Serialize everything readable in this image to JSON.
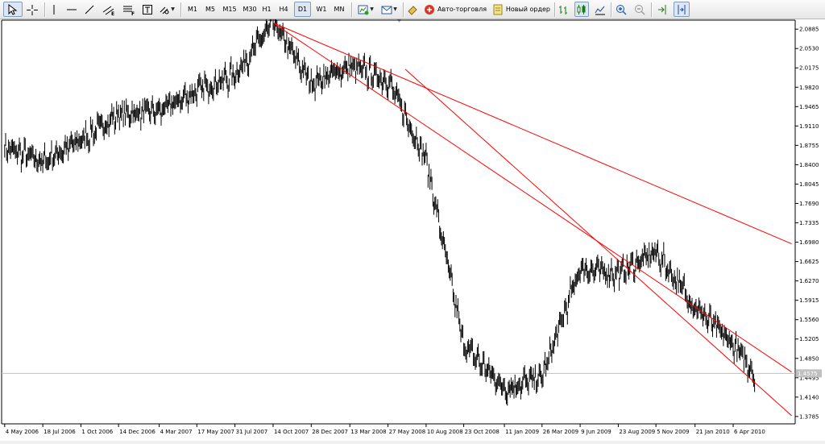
{
  "toolbar": {
    "timeframes": [
      "M1",
      "M5",
      "M15",
      "M30",
      "H1",
      "H4",
      "D1",
      "W1",
      "MN"
    ],
    "active_timeframe": "D1",
    "autotrading_label": "Авто-торговля",
    "new_order_label": "Новый ордер"
  },
  "chart_data": {
    "type": "line",
    "y_ticks": [
      "2.0885",
      "2.0530",
      "2.0175",
      "1.9820",
      "1.9465",
      "1.9110",
      "1.8755",
      "1.8400",
      "1.8045",
      "1.7690",
      "1.7335",
      "1.6980",
      "1.6625",
      "1.6270",
      "1.5915",
      "1.5560",
      "1.5205",
      "1.4850",
      "1.4495",
      "1.4140",
      "1.3785"
    ],
    "x_ticks": [
      "4 May 2006",
      "18 Jul 2006",
      "1 Oct 2006",
      "14 Dec 2006",
      "4 Mar 2007",
      "17 May 2007",
      "31 Jul 2007",
      "14 Oct 2007",
      "28 Dec 2007",
      "13 Mar 2008",
      "27 May 2008",
      "10 Aug 2008",
      "23 Oct 2008",
      "11 Jan 2009",
      "26 Mar 2009",
      "9 Jun 2009",
      "23 Aug 2009",
      "5 Nov 2009",
      "21 Jan 2010",
      "6 Apr 2010"
    ],
    "current_price_label": "1.4575",
    "ylim": [
      1.365,
      2.105
    ],
    "x": [
      "4 May 2006",
      "18 Jul 2006",
      "1 Oct 2006",
      "14 Dec 2006",
      "4 Mar 2007",
      "17 May 2007",
      "31 Jul 2007",
      "14 Oct 2007",
      "28 Dec 2007",
      "13 Mar 2008",
      "27 May 2008",
      "10 Aug 2008",
      "23 Oct 2008",
      "11 Jan 2009",
      "26 Mar 2009",
      "9 Jun 2009",
      "23 Aug 2009",
      "5 Nov 2009",
      "21 Jan 2010",
      "6 Apr 2010",
      "20 May 2010"
    ],
    "close": [
      1.871,
      1.845,
      1.885,
      1.932,
      1.938,
      1.975,
      2.005,
      2.1,
      1.99,
      2.02,
      1.995,
      1.85,
      1.51,
      1.43,
      1.45,
      1.65,
      1.64,
      1.68,
      1.58,
      1.51,
      1.455
    ],
    "trendlines": [
      {
        "from": [
          "14 Oct 2007",
          2.1
        ],
        "to": [
          "30 Jul 2010",
          1.695
        ]
      },
      {
        "from": [
          "14 Oct 2007",
          2.1
        ],
        "to": [
          "30 Jul 2010",
          1.46
        ]
      },
      {
        "from": [
          "30 Jun 2008",
          2.015
        ],
        "to": [
          "30 Jul 2010",
          1.38
        ]
      }
    ],
    "line_color": "#000000",
    "trendline_color": "#ff0000",
    "price_line_color": "#c0c0c0"
  }
}
